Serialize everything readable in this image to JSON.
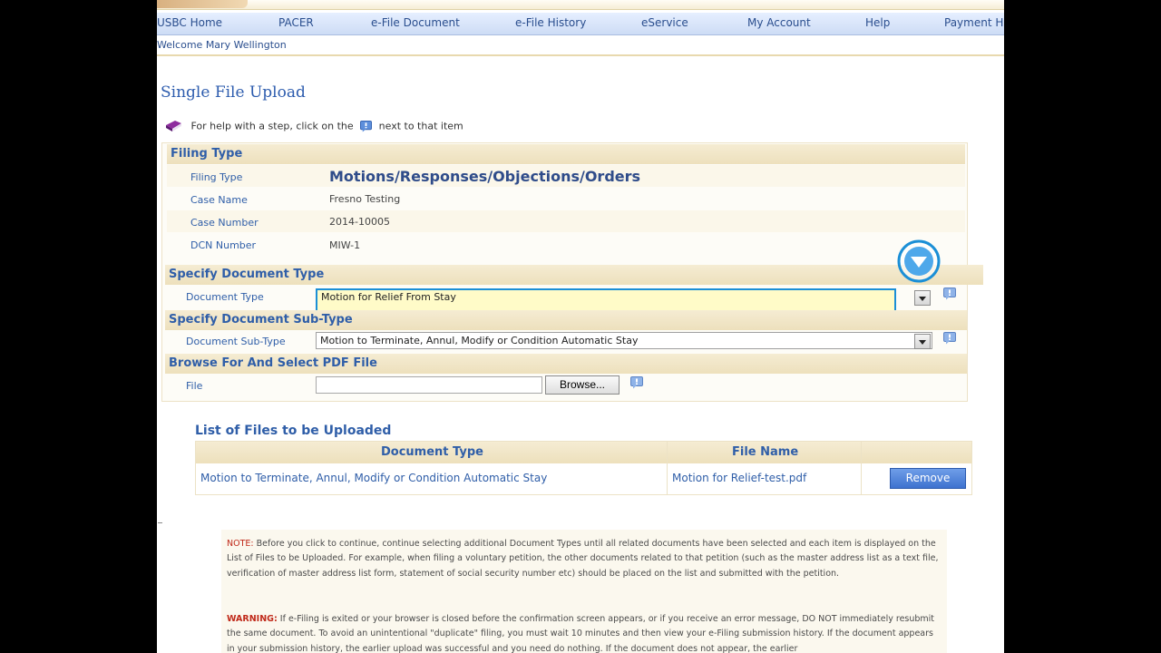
{
  "nav": {
    "items": [
      "USBC Home",
      "PACER",
      "e-File Document",
      "e-File History",
      "eService",
      "My Account",
      "Help",
      "Payment H"
    ]
  },
  "welcome": "Welcome Mary Wellington",
  "page_title": "Single File Upload",
  "help_text": {
    "before": "For help with a step, click on the",
    "after": "next to that item"
  },
  "filing_type": {
    "header": "Filing Type",
    "rows": [
      {
        "label": "Filing Type",
        "value": "Motions/Responses/Objections/Orders"
      },
      {
        "label": "Case Name",
        "value": "Fresno Testing"
      },
      {
        "label": "Case Number",
        "value": "2014-10005"
      },
      {
        "label": "DCN Number",
        "value": "MIW-1"
      }
    ]
  },
  "doc_type": {
    "header": "Specify Document Type",
    "label": "Document Type",
    "selected": "Motion for Relief From Stay"
  },
  "doc_subtype": {
    "header": "Specify Document Sub-Type",
    "label": "Document Sub-Type",
    "selected": "Motion to Terminate, Annul, Modify or Condition Automatic Stay"
  },
  "browse": {
    "header": "Browse For And Select PDF File",
    "label": "File",
    "value": "",
    "button": "Browse..."
  },
  "files_list": {
    "title": "List of Files to be Uploaded",
    "columns": [
      "Document Type",
      "File Name"
    ],
    "rows": [
      {
        "doc_type": "Motion to Terminate, Annul, Modify or Condition Automatic Stay",
        "file_name": "Motion for Relief-test.pdf",
        "action": "Remove"
      }
    ]
  },
  "note": {
    "note_label": "NOTE:",
    "note_text": " Before you click to continue, continue selecting additional Document Types until all related documents have been selected and each item is displayed on the List of Files to be Uploaded. For example, when filing a voluntary petition, the other documents related to that petition (such as the master address list as a text file, verification of master address list form, statement of social security number etc) should be placed on the list and submitted with the petition.",
    "warning_label": "WARNING:",
    "warning_text": " If e-Filing is exited or your browser is closed before the confirmation screen appears, or if you receive an error message, DO NOT immediately resubmit the same document. To avoid an unintentional \"duplicate\" filing, you must wait 10 minutes and then view your e-Filing submission history. If the document appears in your submission history, the earlier upload was successful and you need do nothing. If the document does not appear, the earlier"
  },
  "colors": {
    "accent": "#2f5ea8",
    "section_bg": "#f0e4c4",
    "focus_border": "#1b8fd6",
    "focus_bg": "#fffbc8",
    "remove_button": "#4a7fd8",
    "note_keyword": "#c02a1a"
  }
}
